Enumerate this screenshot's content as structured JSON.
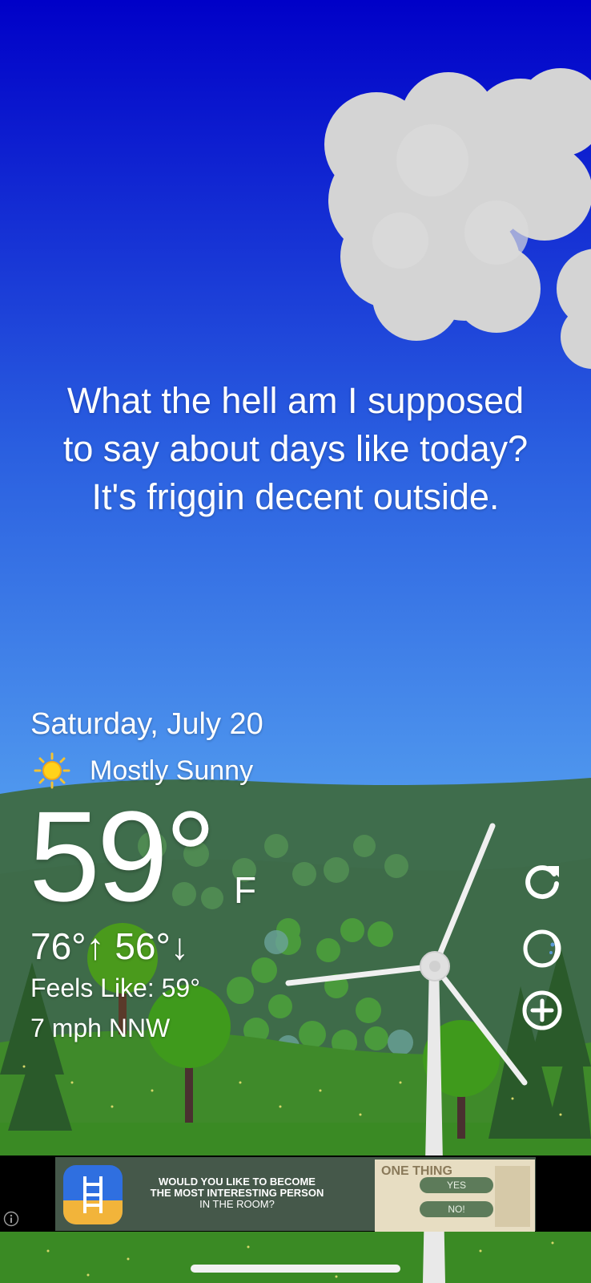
{
  "quote": {
    "line1": "What the hell am I supposed",
    "line2": "to say about days like today?",
    "line3": "It's friggin decent outside."
  },
  "weather": {
    "date": "Saturday, July 20",
    "condition": "Mostly Sunny",
    "condition_icon": "sun-icon",
    "temperature": "59°",
    "unit": "F",
    "high_low": "76°↑ 56°↓",
    "feels_like": "Feels Like: 59°",
    "wind": "7 mph NNW"
  },
  "actions": {
    "refresh_icon": "refresh-icon",
    "moon_icon": "moon-phase-icon",
    "add_icon": "add-location-icon"
  },
  "ad": {
    "headline_line1": "WOULD YOU LIKE TO BECOME",
    "headline_line2": "THE MOST INTERESTING PERSON",
    "headline_line3": "IN THE ROOM?",
    "yes_label": "YES",
    "no_label": "NO!",
    "image_text": "ONE THING"
  },
  "colors": {
    "sky_top": "#0000c8",
    "sky_bottom": "#5aa8f2",
    "hill_far": "#3f6d4c",
    "grass": "#3f8a2a",
    "text": "#ffffff"
  }
}
